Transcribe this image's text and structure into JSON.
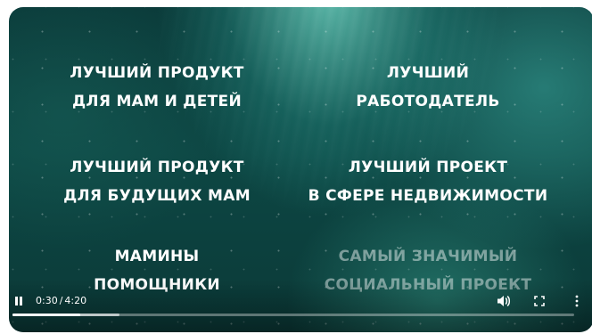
{
  "video": {
    "awards": [
      {
        "line1": "ЛУЧШИЙ ПРОДУКТ",
        "line2": "ДЛЯ МАМ И ДЕТЕЙ"
      },
      {
        "line1": "ЛУЧШИЙ",
        "line2": "РАБОТОДАТЕЛЬ"
      },
      {
        "line1": "ЛУЧШИЙ ПРОДУКТ",
        "line2": "ДЛЯ БУДУЩИХ МАМ"
      },
      {
        "line1": "ЛУЧШИЙ ПРОЕКТ",
        "line2": "В СФЕРЕ НЕДВИЖИМОСТИ"
      },
      {
        "line1": "МАМИНЫ",
        "line2": "ПОМОЩНИКИ"
      },
      {
        "line1": "САМЫЙ ЗНАЧИМЫЙ",
        "line2": "СОЦИАЛЬНЫЙ ПРОЕКТ"
      }
    ]
  },
  "player": {
    "current_time": "0:30",
    "separator": "/",
    "duration": "4:20",
    "progress_fraction": 0.12,
    "buffered_fraction": 0.19,
    "icons": {
      "play_pause": "pause-icon",
      "volume": "volume-icon",
      "fullscreen": "fullscreen-icon",
      "more": "more-vertical-icon"
    }
  }
}
